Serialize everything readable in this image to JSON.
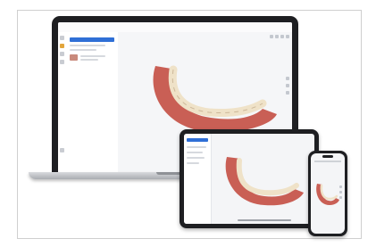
{
  "laptop": {
    "app_title": "",
    "panel_tabs": [
      "",
      ""
    ],
    "panel_texts": [
      "",
      ""
    ]
  },
  "colors": {
    "device_bezel": "#1e1f22",
    "gum": "#c95f55",
    "tooth": "#efe2c8",
    "accent": "#2f6fd6"
  },
  "icons": {
    "rail": "tool-icon",
    "view": "view-control-icon"
  }
}
